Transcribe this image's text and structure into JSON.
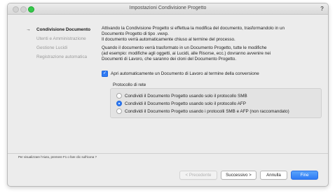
{
  "window": {
    "title": "Impostazioni Condivisione Progetto",
    "help_label": "?"
  },
  "sidebar": {
    "items": [
      {
        "label": "Condivisione Documento",
        "active": true
      },
      {
        "label": "Utenti e Amministrazione",
        "active": false
      },
      {
        "label": "Gestione Lucidi",
        "active": false
      },
      {
        "label": "Registrazione automatica",
        "active": false
      }
    ]
  },
  "content": {
    "paragraph1": "Attivando la Condivisione Progetto si effettua la modifica del documento, trasformandolo in un\nDocumento Progetto di tipo .vwxp.\nIl documento verrà automaticamente chiuso al termine del processo.",
    "paragraph2": "Quando il documento verrà trasformato in un Documento Progetto, tutte le modifiche\n(ad esempio: modifiche agli oggetti, ai Lucidi, alle Risorse, ecc.) dovranno avvenire nei\nDocumenti di Lavoro, che saranno dei cloni del Documento Progetto.",
    "checkbox_label": "Apri automaticamente un Documento di Lavoro al termine della conversione",
    "checkbox_checked": true,
    "protocol_group_label": "Protocollo di rete",
    "protocol_options": [
      {
        "label": "Condividi il Documento Progetto usando solo il protocollo SMB",
        "selected": false
      },
      {
        "label": "Condividi il Documento Progetto usando solo il protocollo AFP",
        "selected": true
      },
      {
        "label": "Condividi il Documento Progetto usando i protocolli SMB e AFP (non raccomandato)",
        "selected": false
      }
    ]
  },
  "status_text": "Per visualizzare l'Aiuto, premere F1 o fare clic sull'icona ?",
  "buttons": {
    "previous": "< Precedente",
    "next": "Successivo >",
    "cancel": "Annulla",
    "finish": "Fine"
  },
  "colors": {
    "accent": "#2f7bf5",
    "window_bg": "#ececec"
  }
}
